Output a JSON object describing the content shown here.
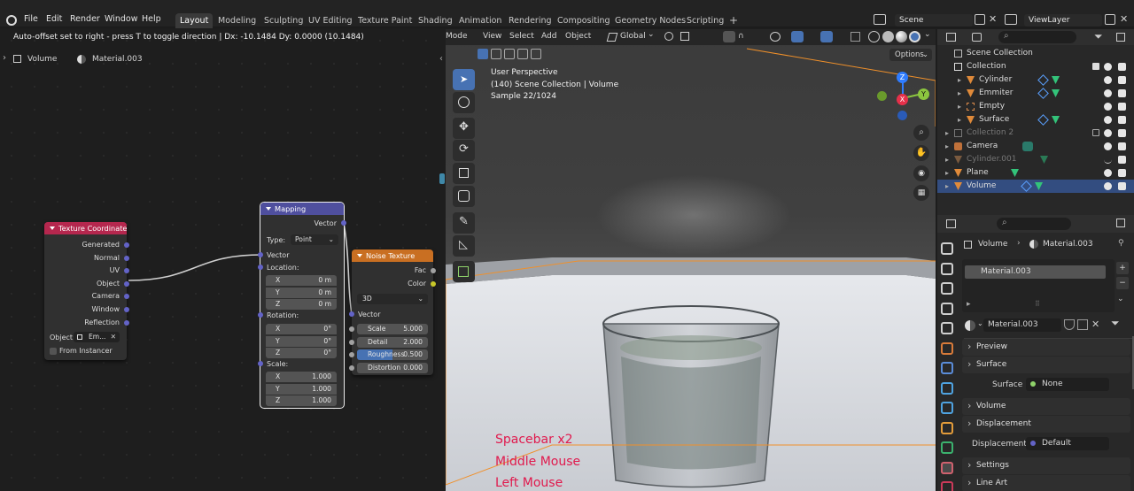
{
  "menu": {
    "items": [
      "File",
      "Edit",
      "Render",
      "Window",
      "Help"
    ]
  },
  "workspaces": [
    "Layout",
    "Modeling",
    "Sculpting",
    "UV Editing",
    "Texture Paint",
    "Shading",
    "Animation",
    "Rendering",
    "Compositing",
    "Geometry Nodes",
    "Scripting"
  ],
  "active_workspace": "Layout",
  "add_workspace": "+",
  "scene": {
    "name": "Scene",
    "view_layer": "ViewLayer"
  },
  "status": {
    "text": "Auto-offset set to right - press T to toggle direction  |  Dx: -10.1484   Dy: 0.0000 (10.1484)"
  },
  "node_editor": {
    "breadcrumb_object": "Volume",
    "breadcrumb_material": "Material.003",
    "texture_coordinate": {
      "title": "Texture Coordinate",
      "outputs": [
        "Generated",
        "Normal",
        "UV",
        "Object",
        "Camera",
        "Window",
        "Reflection"
      ],
      "object_label": "Object:",
      "object_value": "Em...",
      "from_instancer": "From Instancer"
    },
    "mapping": {
      "title": "Mapping",
      "output": "Vector",
      "type_label": "Type:",
      "type_value": "Point",
      "vector_label": "Vector",
      "location_label": "Location:",
      "location": [
        {
          "axis": "X",
          "value": "0 m"
        },
        {
          "axis": "Y",
          "value": "0 m"
        },
        {
          "axis": "Z",
          "value": "0 m"
        }
      ],
      "rotation_label": "Rotation:",
      "rotation": [
        {
          "axis": "X",
          "value": "0°"
        },
        {
          "axis": "Y",
          "value": "0°"
        },
        {
          "axis": "Z",
          "value": "0°"
        }
      ],
      "scale_label": "Scale:",
      "scale": [
        {
          "axis": "X",
          "value": "1.000"
        },
        {
          "axis": "Y",
          "value": "1.000"
        },
        {
          "axis": "Z",
          "value": "1.000"
        }
      ]
    },
    "noise": {
      "title": "Noise Texture",
      "outputs": [
        "Fac",
        "Color"
      ],
      "dimensions": "3D",
      "vector_label": "Vector",
      "fields": [
        {
          "label": "Scale",
          "value": "5.000"
        },
        {
          "label": "Detail",
          "value": "2.000"
        },
        {
          "label": "Roughness",
          "value": "0.500"
        },
        {
          "label": "Distortion",
          "value": "0.000"
        }
      ]
    }
  },
  "viewport": {
    "menus": [
      "Mode",
      "View",
      "Select",
      "Add",
      "Object"
    ],
    "orientation": "Global",
    "options_label": "Options",
    "info": [
      "User Perspective",
      "(140) Scene Collection | Volume",
      "Sample 22/1024"
    ],
    "gizmo": {
      "x": "X",
      "y": "Y",
      "z": "Z"
    },
    "overlays": [
      "Spacebar x2",
      "Middle Mouse",
      "Left Mouse"
    ]
  },
  "outliner": {
    "root": "Scene Collection",
    "rows": [
      {
        "name": "Collection",
        "indent": 1,
        "kind": "collection"
      },
      {
        "name": "Cylinder",
        "indent": 2,
        "kind": "object"
      },
      {
        "name": "Emmiter",
        "indent": 2,
        "kind": "object"
      },
      {
        "name": "Empty",
        "indent": 2,
        "kind": "empty"
      },
      {
        "name": "Surface",
        "indent": 2,
        "kind": "object"
      },
      {
        "name": "Collection 2",
        "indent": 1,
        "kind": "collection-dim"
      },
      {
        "name": "Camera",
        "indent": 1,
        "kind": "camera"
      },
      {
        "name": "Cylinder.001",
        "indent": 1,
        "kind": "object-dim"
      },
      {
        "name": "Plane",
        "indent": 1,
        "kind": "object"
      },
      {
        "name": "Volume",
        "indent": 1,
        "kind": "object",
        "selected": true
      }
    ]
  },
  "properties": {
    "breadcrumb_object": "Volume",
    "breadcrumb_material": "Material.003",
    "slot": "Material.003",
    "material": "Material.003",
    "panels": {
      "preview": "Preview",
      "surface": "Surface",
      "volume": "Volume",
      "displacement": "Displacement",
      "settings": "Settings",
      "line_art": "Line Art"
    },
    "surface_label": "Surface",
    "surface_value": "None",
    "displacement_label": "Displacement",
    "displacement_value": "Default"
  },
  "colors": {
    "accent": "#4772b3",
    "selection": "#334d80",
    "overlay_text": "#e0194d",
    "vector_socket": "#6363c7",
    "color_socket": "#c7c729"
  }
}
